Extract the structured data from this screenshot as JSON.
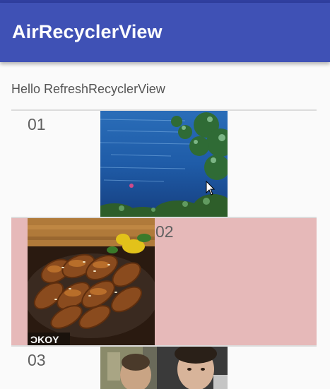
{
  "app_bar": {
    "title": "AirRecyclerView"
  },
  "header": {
    "text": "Hello RefreshRecyclerView"
  },
  "list": {
    "items": [
      {
        "number": "01",
        "image": "lake-photo"
      },
      {
        "number": "02",
        "image": "grilled-chicken-photo"
      },
      {
        "number": "03",
        "image": "person-photo"
      }
    ],
    "row_2_highlight_color": "#e6b9b9"
  },
  "colors": {
    "app_bar": "#3f51b5",
    "status_bar": "#303f9f",
    "background": "#fafafa"
  }
}
